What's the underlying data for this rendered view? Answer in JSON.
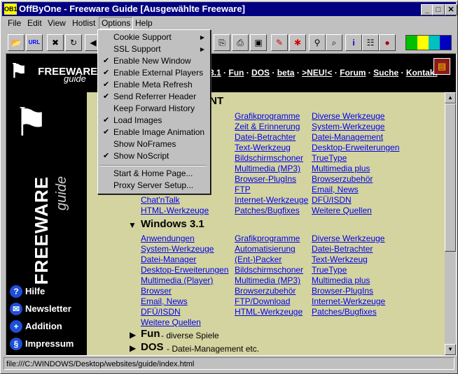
{
  "window": {
    "app_icon": "OB1",
    "title": "OffByOne - Freeware Guide [Ausgewählte Freeware]",
    "controls": {
      "minimize": "_",
      "maximize": "□",
      "close": "✕"
    }
  },
  "menubar": [
    "File",
    "Edit",
    "View",
    "Hotlist",
    "Options",
    "Help"
  ],
  "options_menu": {
    "items": [
      {
        "label": "Cookie Support",
        "checked": false,
        "submenu": true
      },
      {
        "label": "SSL Support",
        "checked": false,
        "submenu": true
      },
      {
        "label": "Enable New Window",
        "checked": true
      },
      {
        "label": "Enable External Players",
        "checked": true
      },
      {
        "label": "Enable Meta Refresh",
        "checked": true
      },
      {
        "label": "Send Referrer Header",
        "checked": true
      },
      {
        "label": "Keep Forward History",
        "checked": false
      },
      {
        "label": "Load Images",
        "checked": true
      },
      {
        "label": "Enable Image Animation",
        "checked": true
      },
      {
        "label": "Show NoFrames",
        "checked": false
      },
      {
        "label": "Show NoScript",
        "checked": true
      }
    ],
    "items2": [
      {
        "label": "Start & Home Page..."
      },
      {
        "label": "Proxy Server Setup..."
      }
    ]
  },
  "toolbar": {
    "icons": [
      "open-folder-icon",
      "url-icon",
      "stop-icon",
      "refresh-icon",
      "back-icon",
      "copy-icon",
      "print-icon",
      "save-icon",
      "color-picker-icon",
      "settings-icon",
      "find-icon",
      "search-icon",
      "info-icon",
      "sitemap-icon",
      "bug-icon"
    ]
  },
  "page": {
    "logo_text": "FREEWARE",
    "logo_sub": "guide",
    "nav": [
      "3.1",
      "Fun",
      "DOS",
      "beta",
      ">NEU!<",
      "Forum",
      "Suche",
      "Kontakt"
    ],
    "sidebar_title": "FREEWARE",
    "sidebar_sub": "guide",
    "sidebar_links": [
      {
        "icon": "?",
        "label": "Hilfe"
      },
      {
        "icon": "✉",
        "label": "Newsletter"
      },
      {
        "icon": "+",
        "label": "Addition"
      },
      {
        "icon": "§",
        "label": "Impressum"
      }
    ],
    "section1_title_partial": "/NT",
    "section1_col1": [
      "Chat'nTalk",
      "HTML-Werkzeuge"
    ],
    "section1_col1_partial": [
      "...)"
    ],
    "section1_col2": [
      "Grafikprogramme",
      "Zeit & Erinnerung",
      "Datei-Betrachter",
      "Text-Werkzeug",
      "Bildschirmschoner",
      "Multimedia (MP3)",
      "Browser-PlugIns",
      "FTP",
      "Internet-Werkzeuge",
      "Patches/Bugfixes"
    ],
    "section1_col3": [
      "Diverse Werkzeuge",
      "System-Werkzeuge",
      "Datei-Management",
      "Desktop-Erweiterungen",
      "TrueType",
      "Multimedia plus",
      "Browserzubehör",
      "Email, News",
      "DFÜ/ISDN",
      "Weitere Quellen"
    ],
    "section2_title": "Windows 3.1",
    "section2_col1": [
      "Anwendungen",
      "System-Werkzeuge",
      "Datei-Manager",
      "Desktop-Erweiterungen",
      "Multimedia (Player)",
      "Browser",
      "Email, News",
      "DFÜ/ISDN",
      "Weitere Quellen"
    ],
    "section2_col2": [
      "Grafikprogramme",
      "Automatisierung",
      "(Ent-)Packer",
      "Bildschirmschoner",
      "Multimedia (MP3)",
      "Browserzubehör",
      "FTP/Download",
      "HTML-Werkzeuge"
    ],
    "section2_col3": [
      "Diverse Werkzeuge",
      "Datei-Betrachter",
      "Text-Werkzeug",
      "TrueType",
      "Multimedia plus",
      "Browser-PlugIns",
      "Internet-Werkzeuge",
      "Patches/Bugfixes"
    ],
    "fun_title": "Fun",
    "fun_desc": "- diverse Spiele",
    "dos_title": "DOS",
    "dos_desc": "- Datei-Management etc."
  },
  "status": "file:///C:/WINDOWS/Desktop/websites/guide/index.html",
  "colors": {
    "titlebar": "#000080",
    "page_bg": "#d4d4a0",
    "link": "#0000ee",
    "sidebar_bg": "#000000"
  }
}
